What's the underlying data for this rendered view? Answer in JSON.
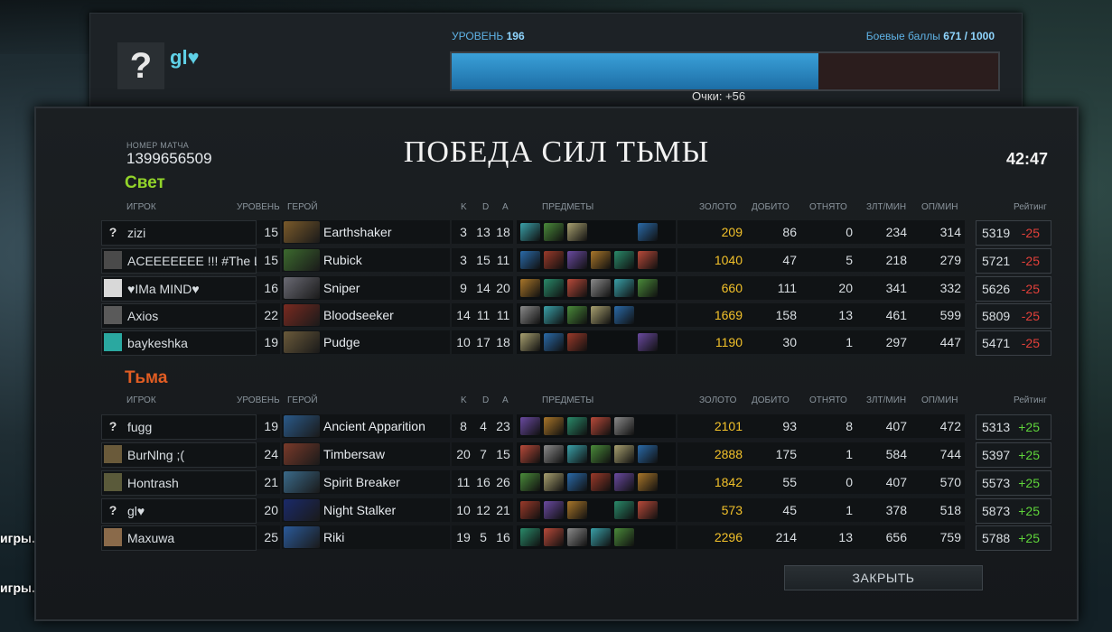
{
  "background_text": [
    "игры.",
    "игры."
  ],
  "profile": {
    "avatar_glyph": "?",
    "name": "gl♥",
    "level_label": "УРОВЕНЬ",
    "level_value": "196",
    "battle_points_label": "Боевые баллы",
    "battle_points_value": "671 / 1000",
    "battle_points_fraction": 0.671,
    "points_text": "Очки: +56"
  },
  "match": {
    "id_label": "НОМЕР МАТЧА",
    "id": "1399656509",
    "title": "ПОБЕДА СИЛ ТЬМЫ",
    "duration": "42:47"
  },
  "headers": {
    "player": "ИГРОК",
    "level": "УРОВЕНЬ",
    "hero": "ГЕРОЙ",
    "k": "K",
    "d": "D",
    "a": "A",
    "items": "ПРЕДМЕТЫ",
    "gold": "ЗОЛОТО",
    "last_hits": "ДОБИТО",
    "denies": "ОТНЯТО",
    "xpm": "ЗЛТ/МИН",
    "gpm": "ОП/МИН",
    "rating": "Рейтинг"
  },
  "teams": [
    {
      "name": "Свет",
      "players": [
        {
          "icon": "?",
          "name": "zizi",
          "level": "15",
          "hero": "Earthshaker",
          "k": "3",
          "d": "13",
          "a": "18",
          "gold": "209",
          "lh": "86",
          "dn": "0",
          "xpm": "234",
          "gpm": "314",
          "rating": "5319",
          "delta": "-25"
        },
        {
          "icon": "",
          "name": "ACEEEEEEE !!! #The La",
          "level": "15",
          "hero": "Rubick",
          "k": "3",
          "d": "15",
          "a": "11",
          "gold": "1040",
          "lh": "47",
          "dn": "5",
          "xpm": "218",
          "gpm": "279",
          "rating": "5721",
          "delta": "-25"
        },
        {
          "icon": "",
          "name": "♥IMa MIND♥",
          "level": "16",
          "hero": "Sniper",
          "k": "9",
          "d": "14",
          "a": "20",
          "gold": "660",
          "lh": "111",
          "dn": "20",
          "xpm": "341",
          "gpm": "332",
          "rating": "5626",
          "delta": "-25"
        },
        {
          "icon": "",
          "name": "Axios",
          "level": "22",
          "hero": "Bloodseeker",
          "k": "14",
          "d": "11",
          "a": "11",
          "gold": "1669",
          "lh": "158",
          "dn": "13",
          "xpm": "461",
          "gpm": "599",
          "rating": "5809",
          "delta": "-25"
        },
        {
          "icon": "",
          "name": "baykeshka",
          "level": "19",
          "hero": "Pudge",
          "k": "10",
          "d": "17",
          "a": "18",
          "gold": "1190",
          "lh": "30",
          "dn": "1",
          "xpm": "297",
          "gpm": "447",
          "rating": "5471",
          "delta": "-25"
        }
      ]
    },
    {
      "name": "Тьма",
      "players": [
        {
          "icon": "?",
          "name": "fugg",
          "level": "19",
          "hero": "Ancient Apparition",
          "k": "8",
          "d": "4",
          "a": "23",
          "gold": "2101",
          "lh": "93",
          "dn": "8",
          "xpm": "407",
          "gpm": "472",
          "rating": "5313",
          "delta": "+25"
        },
        {
          "icon": "",
          "name": "BurNlng ;(",
          "level": "24",
          "hero": "Timbersaw",
          "k": "20",
          "d": "7",
          "a": "15",
          "gold": "2888",
          "lh": "175",
          "dn": "1",
          "xpm": "584",
          "gpm": "744",
          "rating": "5397",
          "delta": "+25"
        },
        {
          "icon": "",
          "name": "Hontrash",
          "level": "21",
          "hero": "Spirit Breaker",
          "k": "11",
          "d": "16",
          "a": "26",
          "gold": "1842",
          "lh": "55",
          "dn": "0",
          "xpm": "407",
          "gpm": "570",
          "rating": "5573",
          "delta": "+25"
        },
        {
          "icon": "?",
          "name": "gl♥",
          "level": "20",
          "hero": "Night Stalker",
          "k": "10",
          "d": "12",
          "a": "21",
          "gold": "573",
          "lh": "45",
          "dn": "1",
          "xpm": "378",
          "gpm": "518",
          "rating": "5873",
          "delta": "+25"
        },
        {
          "icon": "",
          "name": "Maxuwa",
          "level": "25",
          "hero": "Riki",
          "k": "19",
          "d": "5",
          "a": "16",
          "gold": "2296",
          "lh": "214",
          "dn": "13",
          "xpm": "656",
          "gpm": "759",
          "rating": "5788",
          "delta": "+25"
        }
      ]
    }
  ],
  "colors": {
    "radiant": "#92d42a",
    "dire": "#e25d23",
    "loss": "#e2403a",
    "win": "#5fd43a",
    "gold": "#f2c12a"
  },
  "close_button": "ЗАКРЫТЬ"
}
